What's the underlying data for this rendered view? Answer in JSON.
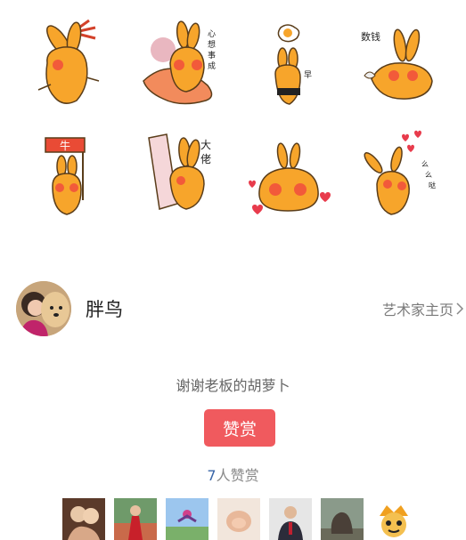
{
  "stickers": [
    {
      "name": "sticker-bunny-with-tassel",
      "text": ""
    },
    {
      "name": "sticker-bunny-with-fish",
      "text": "心想事成"
    },
    {
      "name": "sticker-bunny-with-egg",
      "text": "早"
    },
    {
      "name": "sticker-bunny-counting-money",
      "text": "数钱"
    },
    {
      "name": "sticker-bunny-with-flag",
      "text": "牛"
    },
    {
      "name": "sticker-bunny-with-scroll",
      "text": "大佬"
    },
    {
      "name": "sticker-bunny-with-hearts",
      "text": ""
    },
    {
      "name": "sticker-bunny-love",
      "text": "么么哒"
    }
  ],
  "artist": {
    "name": "胖鸟",
    "home_link": "艺术家主页"
  },
  "reward": {
    "thanks": "谢谢老板的胡萝卜",
    "button": "赞赏",
    "count": "7",
    "count_suffix": "人赞赏"
  },
  "colors": {
    "bunny": "#f7a52b",
    "outline": "#5a3d1a",
    "cheek": "#f25a3a",
    "button": "#f05a5e",
    "count_accent": "#3a66a8"
  }
}
